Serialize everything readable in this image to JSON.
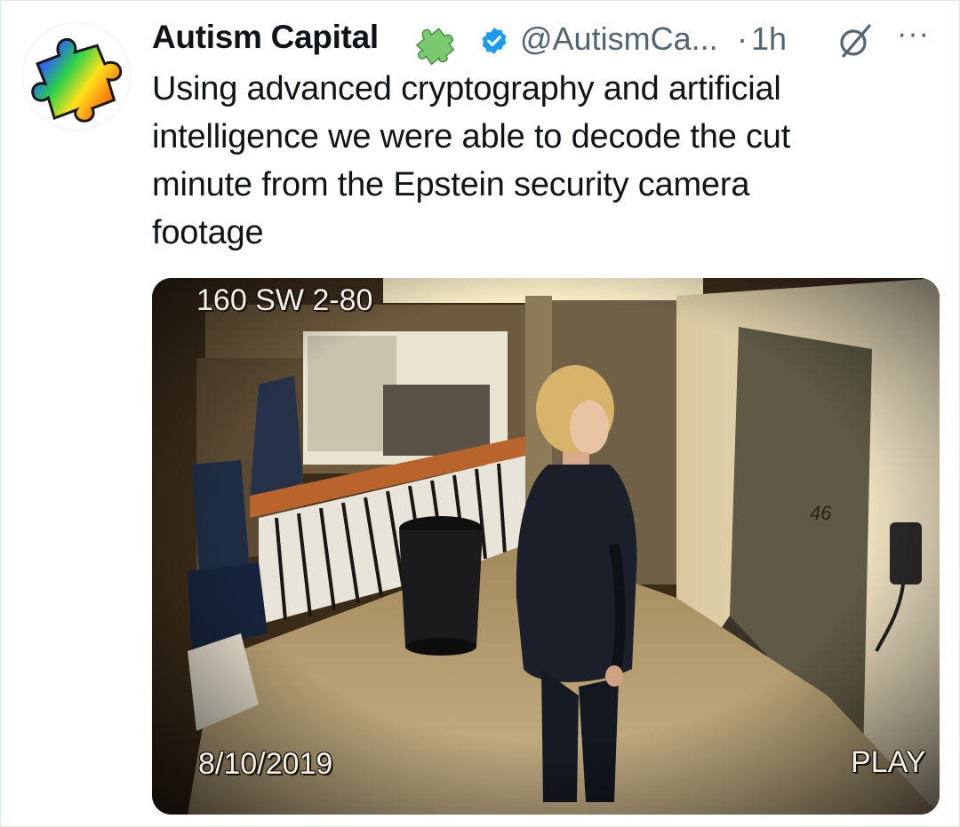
{
  "tweet": {
    "display_name": "Autism Capital",
    "handle": "@AutismCa...",
    "separator": "·",
    "time": "1h",
    "more_label": "···",
    "text": "Using advanced cryptography and artificial\nintelligence we were able to decode the cut\nminute from the Epstein security camera\nfootage",
    "icons": {
      "avatar": "rainbow-puzzle-piece-icon",
      "badge": "green-puzzle-piece-icon",
      "verified": "verified-check-icon",
      "grok": "grok-slash-icon",
      "more": "more-options-icon"
    },
    "colors": {
      "verified": "#1d9bf0",
      "secondary_text": "#536471",
      "name_text": "#0f1419"
    }
  },
  "media": {
    "camera_label": "160 SW 2-80",
    "date_label": "8/10/2019",
    "play_label": "PLAY",
    "door_number": "46"
  }
}
